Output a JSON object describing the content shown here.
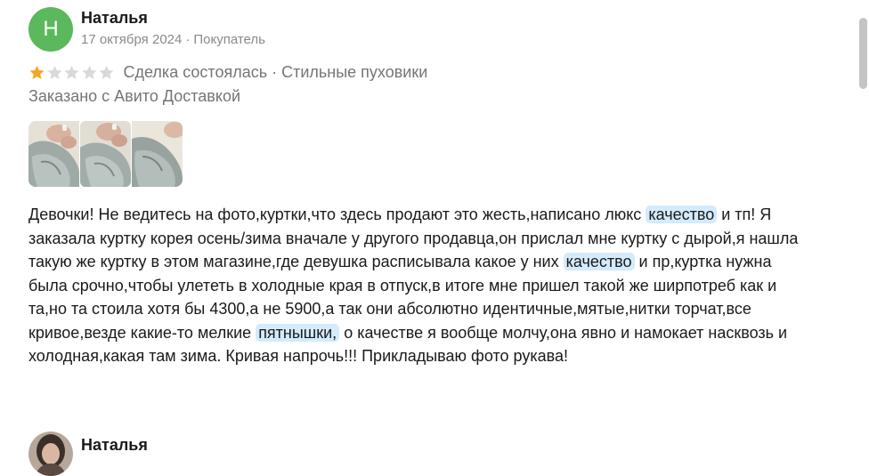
{
  "review": {
    "avatar_letter": "Н",
    "avatar_color": "#5cb85c",
    "author": "Наталья",
    "date": "17 октября 2024",
    "role": "Покупатель",
    "meta_separator": "·",
    "rating": 1,
    "rating_max": 5,
    "star_filled_color": "#f5a623",
    "star_empty_color": "#d9d9d9",
    "deal_status": "Сделка состоялась",
    "product": "Стильные пуховики",
    "delivery": "Заказано с Авито Доставкой",
    "photos": [
      "sleeve-photo-1",
      "sleeve-photo-2",
      "sleeve-photo-3"
    ],
    "text": {
      "p1": "Девочки! Не ведитесь на фото,куртки,что здесь продают это жесть,написано люкс",
      "hl1": "качество",
      "p2": "и тп! Я заказала куртку корея осень/зима вначале у другого продавца,он прислал мне куртку с дырой,я нашла такую же куртку в этом магазине,где девушка расписывала какое у них",
      "hl2": "качество",
      "p3": "и пр,куртка нужна была срочно,чтобы улететь в холодные края в отпуск,в итоге мне пришел такой же ширпотреб как и та,но та стоила хотя бы 4300,а не 5900,а так они абсолютно идентичные,мятые,нитки торчат,все кривое,везде какие-то мелкие",
      "hl3": "пятнышки,",
      "p4": "о качестве я вообще молчу,она явно и намокает насквозь и холодная,какая там зима. Кривая напрочь!!! Прикладываю фото рукава!"
    },
    "highlight_color": "#d3ebfc"
  },
  "next_review": {
    "author": "Наталья"
  }
}
